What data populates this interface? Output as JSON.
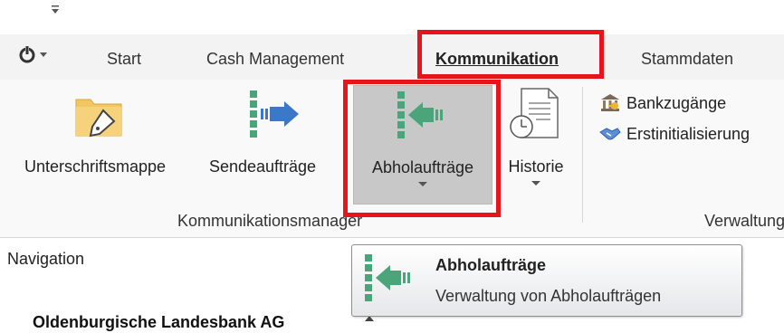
{
  "quick_access": {
    "customize_icon": "chevron-down-icon"
  },
  "tabs": [
    {
      "label": "Start"
    },
    {
      "label": "Cash Management"
    },
    {
      "label": "Kommunikation",
      "active": true
    },
    {
      "label": "Stammdaten"
    }
  ],
  "ribbon": {
    "group_kommunikation": {
      "label": "Kommunikationsmanager",
      "buttons": [
        {
          "label": "Unterschriftsmappe",
          "icon": "folder-pen-icon"
        },
        {
          "label": "Sendeaufträge",
          "icon": "send-orders-icon"
        },
        {
          "label": "Abholaufträge",
          "icon": "fetch-orders-icon"
        },
        {
          "label": "Historie",
          "icon": "history-icon"
        }
      ]
    },
    "group_verwaltung": {
      "label": "Verwaltung",
      "buttons": [
        {
          "label": "Bankzugänge",
          "icon": "bank-access-icon"
        },
        {
          "label": "Erstinitialisierung",
          "icon": "handshake-icon"
        }
      ]
    }
  },
  "navigation": {
    "label": "Navigation",
    "bank_name": "Oldenburgische Landesbank AG"
  },
  "tooltip": {
    "title": "Abholaufträge",
    "description": "Verwaltung von Abholaufträgen"
  },
  "colors": {
    "highlight": "#e8141b",
    "icon_green": "#4aa57a",
    "icon_blue": "#3b78c8"
  }
}
